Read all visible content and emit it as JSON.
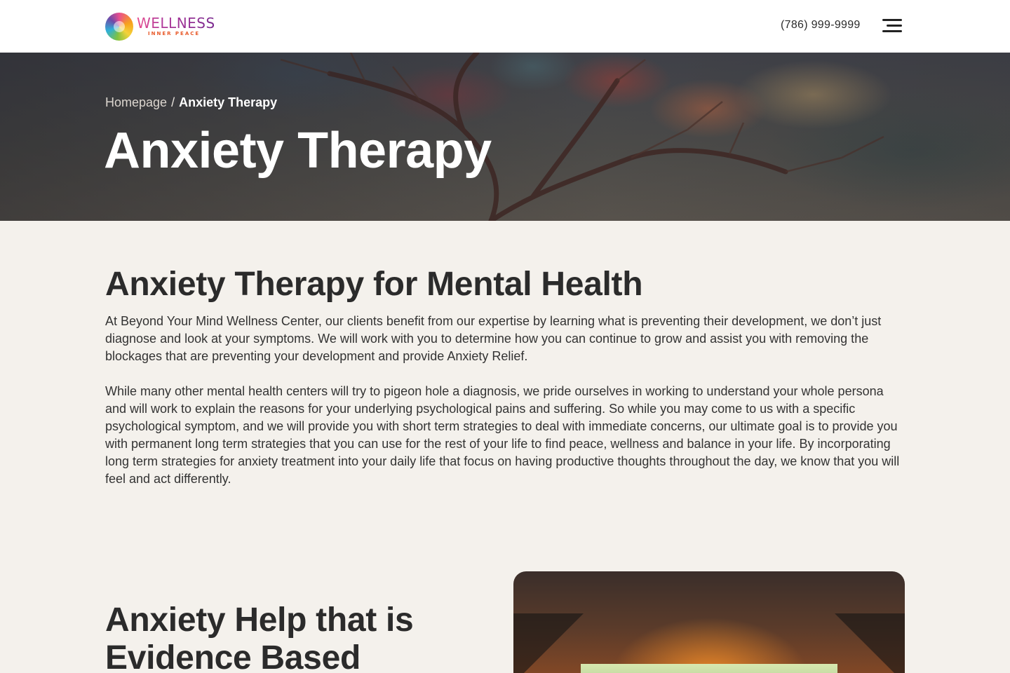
{
  "header": {
    "logo": {
      "title": "WELLNESS",
      "subtitle": "INNER PEACE",
      "icon": "lotus-logo-icon"
    },
    "phone": "(786) 999-9999",
    "menu_icon": "hamburger-menu-icon"
  },
  "hero": {
    "breadcrumb": {
      "home": "Homepage",
      "separator": "/",
      "current": "Anxiety Therapy"
    },
    "title": "Anxiety Therapy"
  },
  "main": {
    "section_title": "Anxiety Therapy for Mental Health",
    "paragraphs": [
      "At Beyond Your Mind Wellness Center, our clients benefit from our expertise by learning what is preventing their development, we don’t just diagnose and look at your symptoms.  We will work with you to determine how you can continue to grow and assist you with removing the blockages that are preventing your development and provide Anxiety Relief.",
      "While many other mental health centers will try to pigeon hole a diagnosis, we pride ourselves in working to understand your whole persona and will work to explain the reasons for your underlying psychological pains and suffering. So while you may come to us with a specific psychological symptom, and we will provide you with short term strategies to deal with immediate concerns, our ultimate goal is to provide you with permanent long term strategies that you can use for the rest of your life to find peace, wellness and balance in your life. By incorporating long term strategies for anxiety treatment into your daily life that focus on having  productive thoughts throughout the day, we know that you will feel and act differently."
    ],
    "second_section_title": "Anxiety Help that is Evidence Based"
  },
  "colors": {
    "page_background": "#f4f1ec",
    "header_background": "#ffffff",
    "heading_text": "#2b2b2b",
    "logo_purple": "#7a2a8f",
    "logo_orange": "#e85a2a"
  }
}
